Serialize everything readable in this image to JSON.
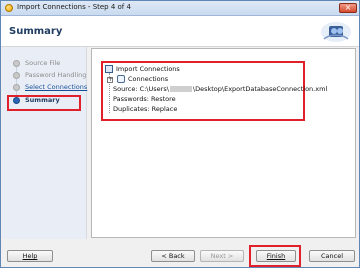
{
  "window": {
    "title": "Import Connections - Step 4 of 4",
    "close_glyph": "×"
  },
  "header": {
    "title": "Summary"
  },
  "steps": [
    {
      "label": "Source File",
      "state": "completed"
    },
    {
      "label": "Password Handling",
      "state": "completed"
    },
    {
      "label": "Select Connections",
      "state": "link"
    },
    {
      "label": "Summary",
      "state": "current"
    }
  ],
  "summary_tree": {
    "root": "Import Connections",
    "connections_label": "Connections",
    "source_prefix": "Source: C:\\Users\\",
    "source_suffix": "\\Desktop\\ExportDatabaseConnection.xml",
    "passwords": "Passwords: Restore",
    "duplicates": "Duplicates: Replace"
  },
  "buttons": {
    "help": "Help",
    "back": "< Back",
    "next": "Next >",
    "finish": "Finish",
    "cancel": "Cancel"
  },
  "icons": {
    "app": "app-icon",
    "logo": "import-connections-logo-icon",
    "tree_root": "import-connections-icon",
    "connections": "connections-icon"
  },
  "colors": {
    "accent": "#1f3c61",
    "highlight": "#e0202a"
  }
}
